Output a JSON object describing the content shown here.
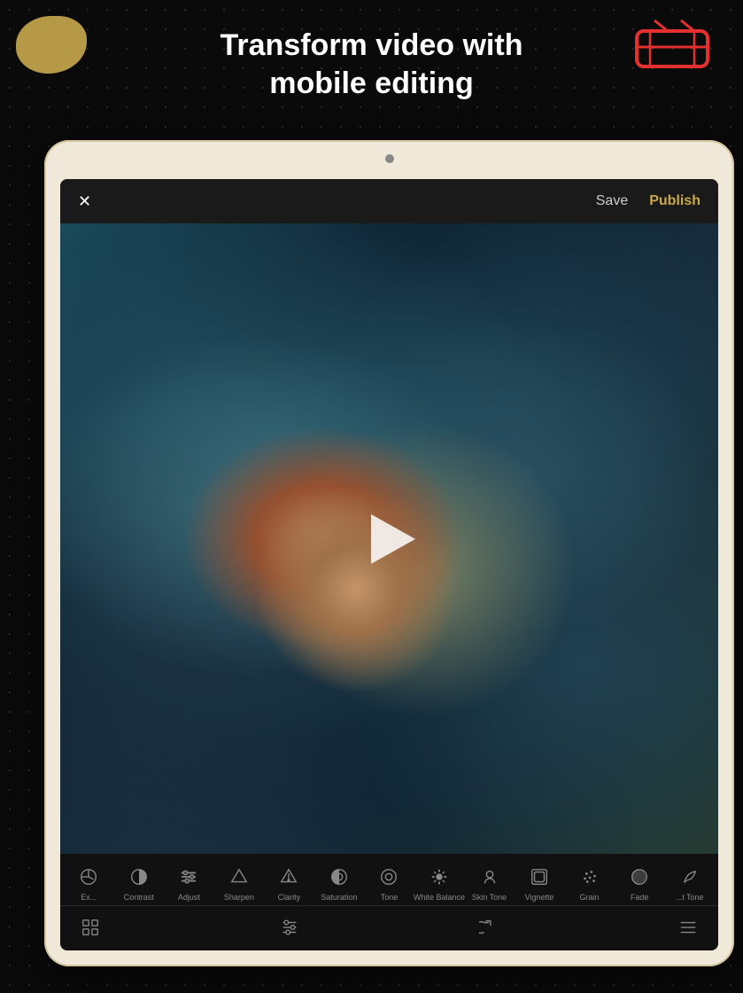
{
  "page": {
    "background_color": "#0a0a0a",
    "title_line1": "Transform video with",
    "title_line2": "mobile editing"
  },
  "header": {
    "title": "Transform video with\nmobile editing"
  },
  "tablet": {
    "top_bar": {
      "close_label": "✕",
      "save_label": "Save",
      "publish_label": "Publish"
    },
    "video": {
      "play_button_label": "Play"
    },
    "tools": [
      {
        "id": "exposure",
        "label": "Ex..."
      },
      {
        "id": "contrast",
        "label": "Contrast"
      },
      {
        "id": "adjust",
        "label": "Adjust"
      },
      {
        "id": "sharpen",
        "label": "Sharpen"
      },
      {
        "id": "clarity",
        "label": "Clarity"
      },
      {
        "id": "saturation",
        "label": "Saturation"
      },
      {
        "id": "tone",
        "label": "Tone"
      },
      {
        "id": "white-balance",
        "label": "White Balance"
      },
      {
        "id": "skin-tone",
        "label": "Skin Tone"
      },
      {
        "id": "vignette",
        "label": "Vignette"
      },
      {
        "id": "grain",
        "label": "Grain"
      },
      {
        "id": "fade",
        "label": "Fade"
      },
      {
        "id": "split-tone",
        "label": "...t Tone"
      }
    ],
    "bottom_nav": [
      {
        "id": "grid",
        "label": "Grid"
      },
      {
        "id": "sliders",
        "label": "Sliders"
      },
      {
        "id": "undo",
        "label": "Undo"
      },
      {
        "id": "menu",
        "label": "Menu"
      }
    ]
  }
}
